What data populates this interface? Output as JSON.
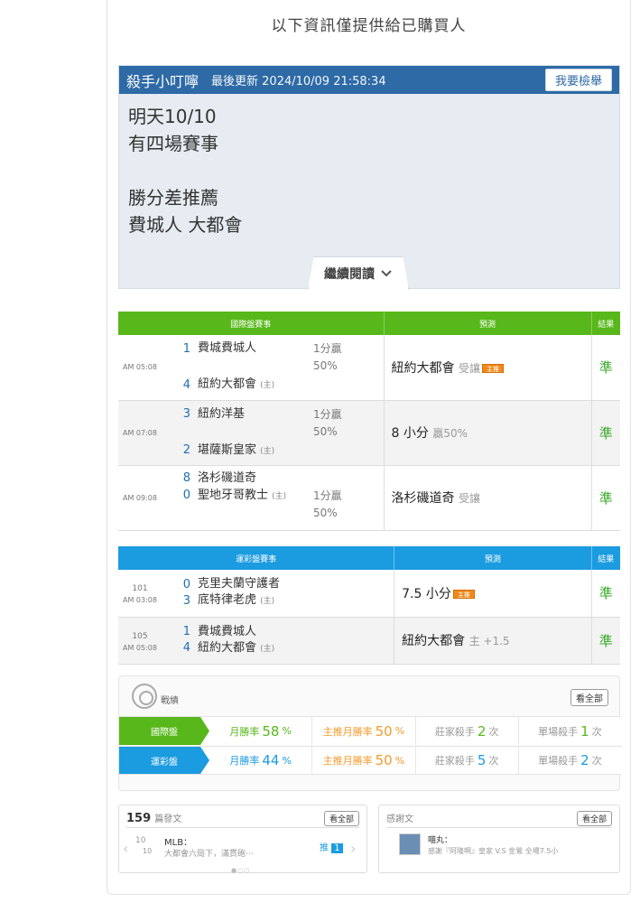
{
  "notice": "以下資訊僅提供給已購買人",
  "post": {
    "author": "殺手小叮嚀",
    "updated": "最後更新 2024/10/09 21:58:34",
    "report_label": "我要檢舉",
    "lines": [
      "明天10/10",
      "有四場賽事",
      "",
      "勝分差推薦",
      "費城人 大都會"
    ],
    "read_more": "繼續閱讀"
  },
  "intl_table": {
    "headers": [
      "國際盤賽事",
      "預測",
      "結果"
    ],
    "home_mark": "(主)",
    "rows": [
      {
        "time": "AM 05:08",
        "away_score": "1",
        "away": "費城費城人",
        "home_score": "4",
        "home": "紐約大都會",
        "odds": "1分贏",
        "odds_pct": "50%",
        "pred": "紐約大都會",
        "pred_note": "受讓",
        "pred_tag": "主推",
        "result": "準"
      },
      {
        "time": "AM 07:08",
        "away_score": "3",
        "away": "紐約洋基",
        "home_score": "2",
        "home": "堪薩斯皇家",
        "odds": "1分贏",
        "odds_pct": "50%",
        "pred": "8 小分",
        "pred_note": "贏50%",
        "pred_tag": "",
        "result": "準"
      },
      {
        "time": "AM 09:08",
        "away_score": "8",
        "away": "洛杉磯道奇",
        "home_score": "0",
        "home": "聖地牙哥教士",
        "odds": "1分贏",
        "odds_pct": "50%",
        "pred": "洛杉磯道奇",
        "pred_note": "受讓",
        "pred_tag": "",
        "result": "準"
      }
    ]
  },
  "sport_table": {
    "headers": [
      "運彩盤賽事",
      "預測",
      "結果"
    ],
    "rows": [
      {
        "no": "101",
        "time": "AM 03:08",
        "away_score": "0",
        "away": "克里夫蘭守護者",
        "home_score": "3",
        "home": "底特律老虎",
        "pred": "7.5 小分",
        "pred_note": "",
        "pred_tag": "主推",
        "result": "準"
      },
      {
        "no": "105",
        "time": "AM 05:08",
        "away_score": "1",
        "away": "費城費城人",
        "home_score": "4",
        "home": "紐約大都會",
        "pred": "紐約大都會",
        "pred_note": "主 +1.5",
        "pred_tag": "",
        "result": "準"
      }
    ]
  },
  "stats": {
    "title": "戰績",
    "all_label": "看全部",
    "rows": [
      {
        "label": "國際盤",
        "color": "#58b81b",
        "month_label": "月勝率",
        "month_val": "58",
        "pct": "%",
        "main_label": "主推月勝率",
        "main_val": "50",
        "banker_label": "莊家殺手",
        "banker_val": "2",
        "single_label": "單場殺手",
        "single_val": "1",
        "times": "次"
      },
      {
        "label": "運彩盤",
        "color": "#1b9be0",
        "month_label": "月勝率",
        "month_val": "44",
        "pct": "%",
        "main_label": "主推月勝率",
        "main_val": "50",
        "banker_label": "莊家殺手",
        "banker_val": "5",
        "single_label": "單場殺手",
        "single_val": "2",
        "times": "次"
      }
    ]
  },
  "articles": {
    "count": "159",
    "count_label": "篇發文",
    "all_label": "看全部",
    "date_day": "10",
    "date_month": "10",
    "title": "MLB：",
    "excerpt": "大都會六局下，滿貫砲⋯",
    "push_label": "推",
    "push_count": "1"
  },
  "thanks": {
    "title": "感謝文",
    "all_label": "看全部",
    "user": "喵丸：",
    "text": "感謝『阿隆啊』皇家 V.S 金鶯 全場7.5小"
  }
}
